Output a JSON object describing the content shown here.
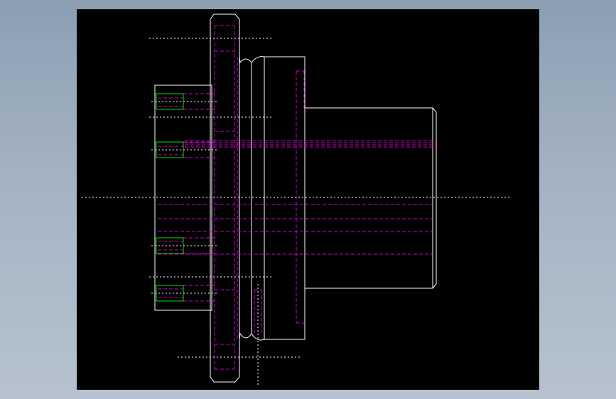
{
  "viewer": {
    "background_color": "#8c9fb2",
    "sheet_color": "#000000"
  },
  "drawing": {
    "view": "side-view-flange-coupling",
    "colors": {
      "outline": "#ffffff",
      "hidden": "#d000d0",
      "center": "#ffffff",
      "thread": "#00e000"
    }
  }
}
